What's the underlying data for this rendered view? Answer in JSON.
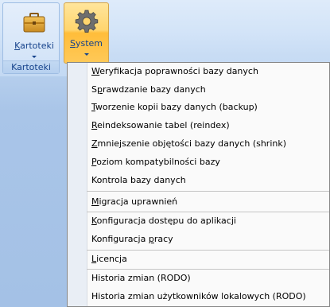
{
  "ribbon": {
    "group_label": "Kartoteki",
    "buttons": [
      {
        "id": "kartoteki",
        "accel": "K",
        "rest": "artoteki",
        "icon": "briefcase-icon",
        "has_dropdown": true
      },
      {
        "id": "system",
        "accel": "S",
        "rest": "ystem",
        "icon": "gear-icon",
        "has_dropdown": true,
        "active": true
      }
    ]
  },
  "menu": {
    "items": [
      {
        "accel": "W",
        "rest": "eryfikacja poprawności bazy danych"
      },
      {
        "pre": "S",
        "accel": "p",
        "rest": "rawdzanie bazy danych"
      },
      {
        "accel": "T",
        "rest": "worzenie kopii bazy danych (backup)"
      },
      {
        "accel": "R",
        "rest": "eindeksowanie tabel (reindex)"
      },
      {
        "accel": "Z",
        "rest": "mniejszenie objętości bazy danych (shrink)"
      },
      {
        "accel": "P",
        "rest": "oziom kompatybilności bazy"
      },
      {
        "pre": "",
        "accel": "",
        "rest": "Kontrola bazy danych"
      },
      {
        "pre": "",
        "accel": "M",
        "rest": "igracja uprawnień"
      },
      {
        "accel": "K",
        "rest": "onfiguracja dostępu do aplikacji"
      },
      {
        "pre": "Konfiguracja ",
        "accel": "p",
        "rest": "racy"
      },
      {
        "accel": "L",
        "rest": "icencja"
      },
      {
        "pre": "",
        "accel": "",
        "rest": "Historia zmian (RODO)"
      },
      {
        "pre": "",
        "accel": "",
        "rest": "Historia zmian użytkowników lokalowych (RODO)"
      }
    ]
  }
}
